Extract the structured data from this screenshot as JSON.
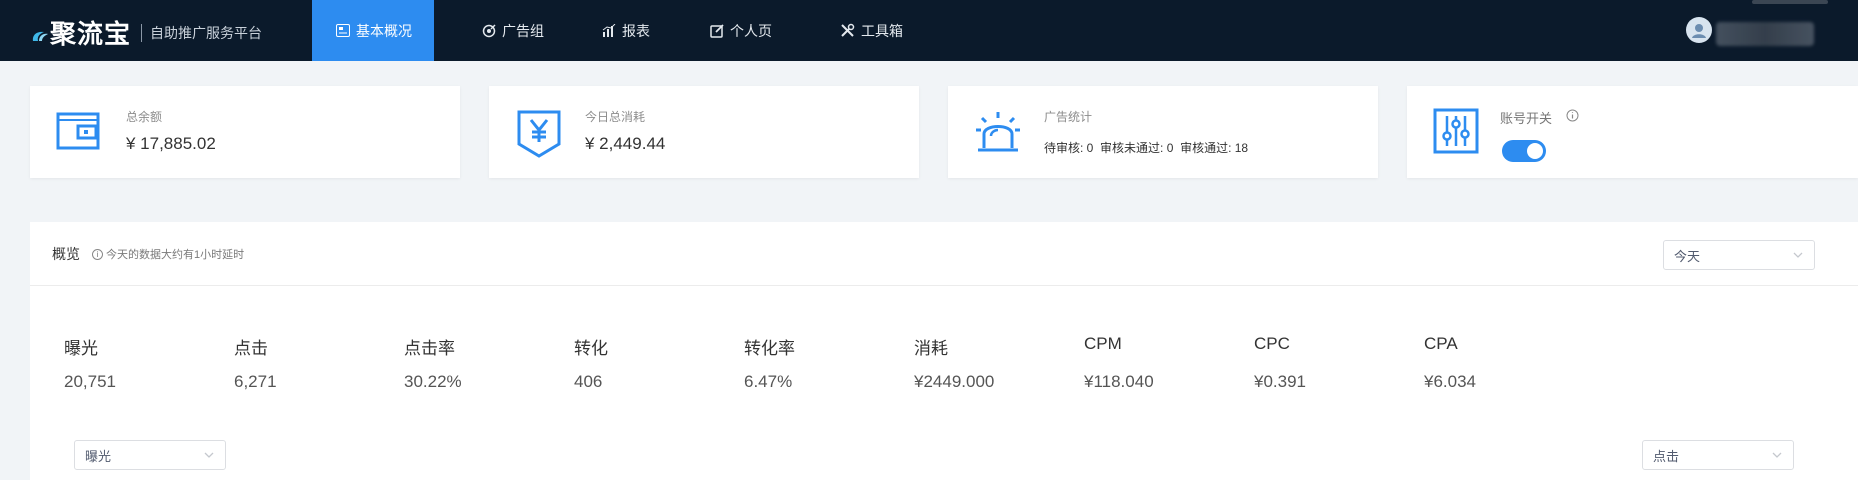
{
  "header": {
    "logo_text": "聚流宝",
    "logo_subtitle": "自助推广服务平台",
    "nav": [
      {
        "label": "基本概况",
        "icon": "chart-image-icon",
        "active": true
      },
      {
        "label": "广告组",
        "icon": "target-icon",
        "active": false
      },
      {
        "label": "报表",
        "icon": "bar-chart-icon",
        "active": false
      },
      {
        "label": "个人页",
        "icon": "edit-icon",
        "active": false
      },
      {
        "label": "工具箱",
        "icon": "tools-icon",
        "active": false
      }
    ],
    "accent_color": "#2d8cf0",
    "bg_color": "#0b1a2b"
  },
  "cards": {
    "balance": {
      "label": "总余额",
      "value": "¥ 17,885.02",
      "icon": "wallet-icon"
    },
    "today_spend": {
      "label": "今日总消耗",
      "value": "¥ 2,449.44",
      "icon": "yen-icon"
    },
    "ad_stats": {
      "label": "广告统计",
      "pending_label": "待审核: ",
      "pending": "0",
      "rejected_label": "审核未通过: ",
      "rejected": "0",
      "approved_label": "审核通过: ",
      "approved": "18",
      "icon": "alarm-light-icon"
    },
    "account_switch": {
      "label": "账号开关",
      "icon": "sliders-icon",
      "enabled": true
    }
  },
  "overview": {
    "title": "概览",
    "note": "今天的数据大约有1小时延时",
    "range_select": "今天",
    "metrics": [
      {
        "name": "曝光",
        "value": "20,751"
      },
      {
        "name": "点击",
        "value": "6,271"
      },
      {
        "name": "点击率",
        "value": "30.22%"
      },
      {
        "name": "转化",
        "value": "406"
      },
      {
        "name": "转化率",
        "value": "6.47%"
      },
      {
        "name": "消耗",
        "value": "¥2449.000"
      },
      {
        "name": "CPM",
        "value": "¥118.040"
      },
      {
        "name": "CPC",
        "value": "¥0.391"
      },
      {
        "name": "CPA",
        "value": "¥6.034"
      }
    ],
    "left_select": "曝光",
    "right_select": "点击"
  }
}
